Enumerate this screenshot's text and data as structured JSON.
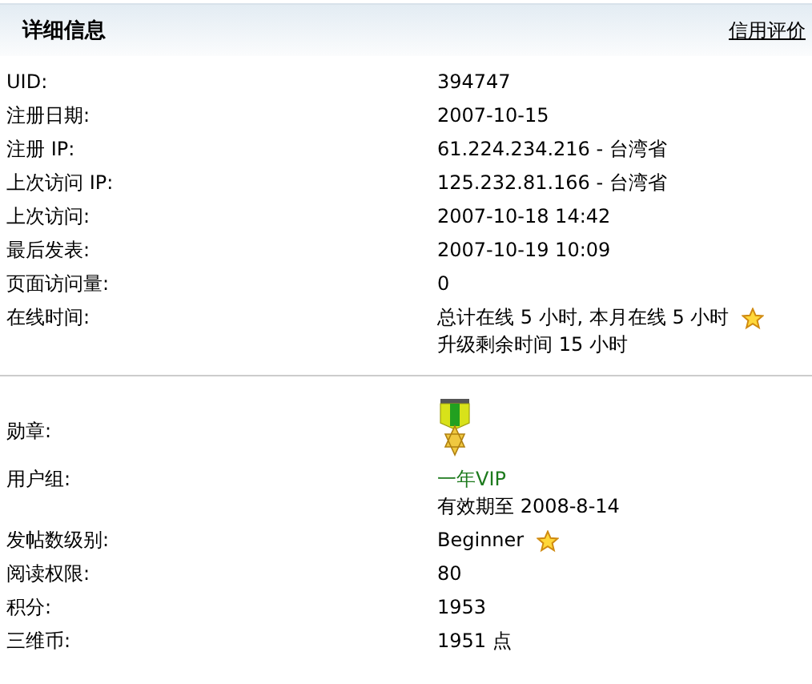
{
  "header": {
    "title": "详细信息",
    "link": "信用评价"
  },
  "sections": [
    {
      "rows": [
        {
          "label": "UID:",
          "kind": "text",
          "lines": [
            {
              "text": "394747",
              "kind": "plain",
              "star": false
            }
          ]
        },
        {
          "label": "注册日期:",
          "kind": "text",
          "lines": [
            {
              "text": "2007-10-15",
              "kind": "plain",
              "star": false
            }
          ]
        },
        {
          "label": "注册 IP:",
          "kind": "text",
          "lines": [
            {
              "text": "61.224.234.216 - 台湾省",
              "kind": "plain",
              "star": false
            }
          ]
        },
        {
          "label": "上次访问 IP:",
          "kind": "text",
          "lines": [
            {
              "text": "125.232.81.166 - 台湾省",
              "kind": "plain",
              "star": false
            }
          ]
        },
        {
          "label": "上次访问:",
          "kind": "text",
          "lines": [
            {
              "text": "2007-10-18 14:42",
              "kind": "plain",
              "star": false
            }
          ]
        },
        {
          "label": "最后发表:",
          "kind": "text",
          "lines": [
            {
              "text": "2007-10-19 10:09",
              "kind": "plain",
              "star": false
            }
          ]
        },
        {
          "label": "页面访问量:",
          "kind": "text",
          "lines": [
            {
              "text": "0",
              "kind": "plain",
              "star": false
            }
          ]
        },
        {
          "label": "在线时间:",
          "kind": "text",
          "lines": [
            {
              "text": "总计在线  5 小时, 本月在线  5 小时",
              "kind": "plain",
              "star": true
            },
            {
              "text": "升级剩余时间  15 小时",
              "kind": "plain",
              "star": false
            }
          ]
        }
      ]
    },
    {
      "rows": [
        {
          "label": "勋章:",
          "kind": "medal"
        },
        {
          "label": "用户组:",
          "kind": "text",
          "lines": [
            {
              "text": "一年VIP",
              "kind": "group",
              "star": false
            },
            {
              "text": "有效期至  2008-8-14",
              "kind": "plain",
              "star": false
            }
          ]
        },
        {
          "label": "发帖数级别:",
          "kind": "text",
          "lines": [
            {
              "text": "Beginner",
              "kind": "plain",
              "star": true
            }
          ]
        },
        {
          "label": "阅读权限:",
          "kind": "text",
          "lines": [
            {
              "text": "80",
              "kind": "plain",
              "star": false
            }
          ]
        },
        {
          "label": "积分:",
          "kind": "text",
          "lines": [
            {
              "text": "1953",
              "kind": "plain",
              "star": false
            }
          ]
        },
        {
          "label": "三维币:",
          "kind": "text",
          "lines": [
            {
              "text": "1951 点",
              "kind": "plain",
              "star": false
            }
          ]
        }
      ]
    }
  ]
}
